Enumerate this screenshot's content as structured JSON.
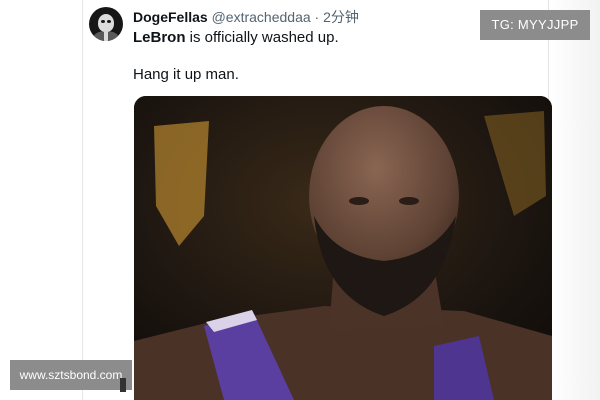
{
  "tweet": {
    "author": {
      "display_name": "DogeFellas",
      "handle": "@extracheddaa",
      "separator": "·",
      "time_ago": "2分钟"
    },
    "text": {
      "line1_bold": "LeBron",
      "line1_rest": " is officially washed up.",
      "line2": "Hang it up man."
    },
    "media": {
      "icon": "photo-of-basketball-player"
    }
  },
  "watermarks": {
    "top_right": "TG: MYYJJPP",
    "bottom_left": "www.sztsbond.com"
  },
  "colors": {
    "primary_text": "#0f1419",
    "secondary_text": "#536471",
    "watermark_bg": "#8c8c8c",
    "jersey_purple": "#5a3fa0"
  }
}
